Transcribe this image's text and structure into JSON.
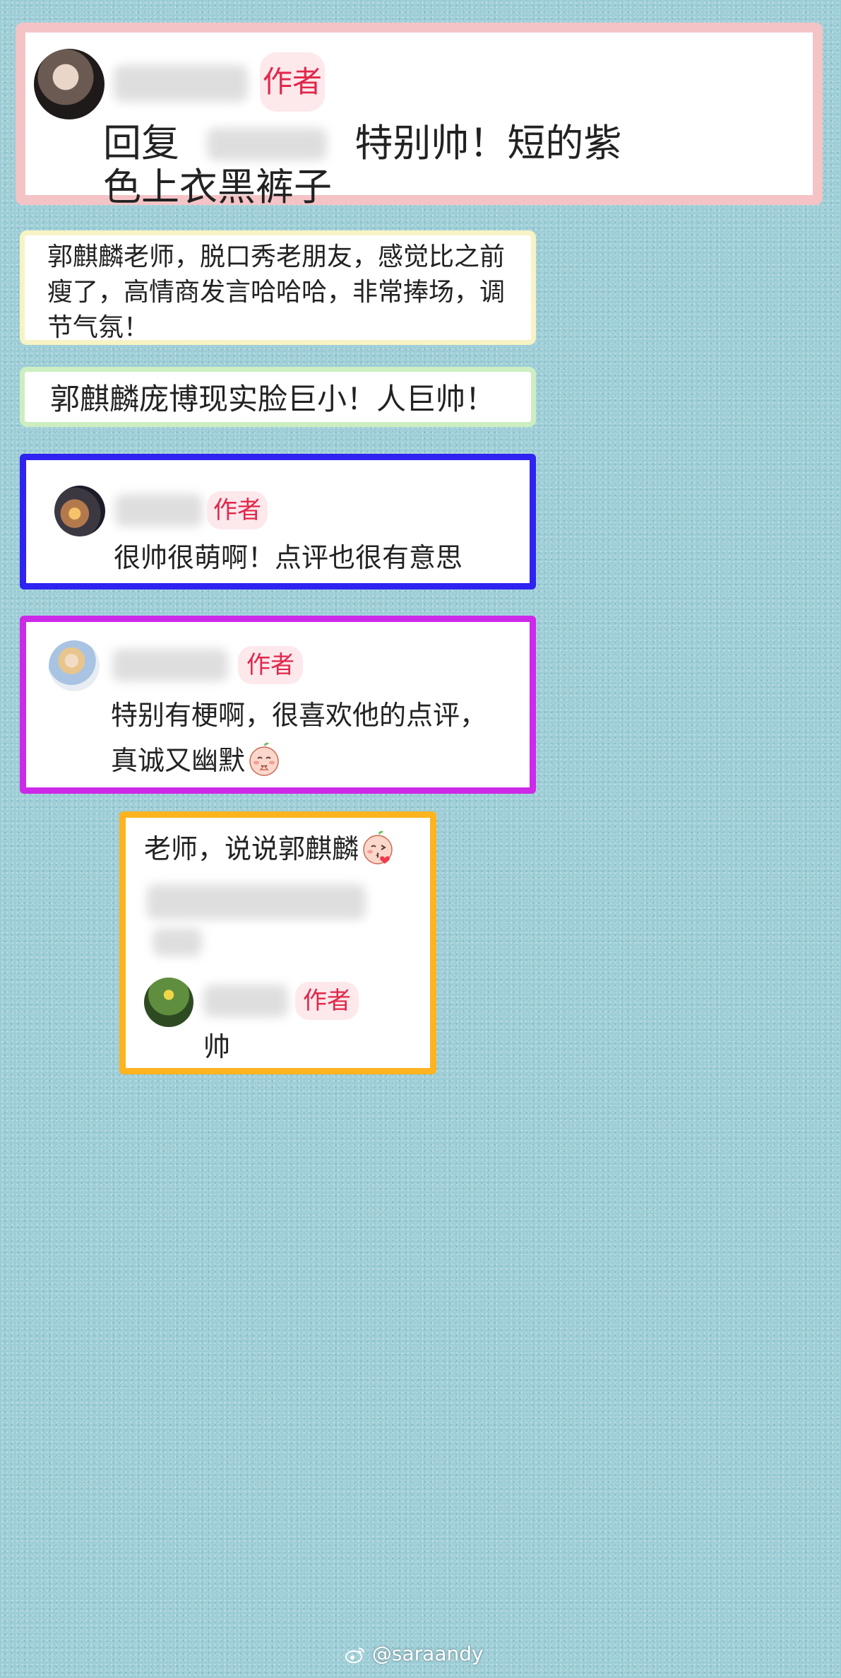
{
  "colors": {
    "background": "#9ccdd6",
    "card1_border": "#f4c3c6",
    "card2_border": "#f7f3c4",
    "card3_border": "#cdeec0",
    "card4_border": "#2e23f0",
    "card5_border": "#cc29e8",
    "card6_border": "#ffb31f",
    "badge_text": "#e0284a",
    "badge_bg": "#fde8ec"
  },
  "comments": [
    {
      "badge": "作者",
      "reply_prefix": "回复",
      "text_line1": "特别帅！短的紫",
      "text_line2": "色上衣黑裤子"
    },
    {
      "lines": [
        "郭麒麟老师，脱口秀老朋友，感觉比之前",
        "瘦了，高情商发言哈哈哈，非常捧场，调",
        "节气氛！"
      ]
    },
    {
      "text": "郭麒麟庞博现实脸巨小！人巨帅！"
    },
    {
      "badge": "作者",
      "text": "很帅很萌啊！点评也很有意思"
    },
    {
      "badge": "作者",
      "text_line1": "特别有梗啊，很喜欢他的点评，",
      "text_line2": "真诚又幽默",
      "emoji": "peach-face-praying-icon"
    },
    {
      "question": "老师，说说郭麒麟",
      "question_emoji": "peach-face-kiss-icon",
      "badge": "作者",
      "reply": "帅"
    }
  ],
  "watermark": {
    "icon": "weibo-icon",
    "handle": "@saraandy"
  }
}
